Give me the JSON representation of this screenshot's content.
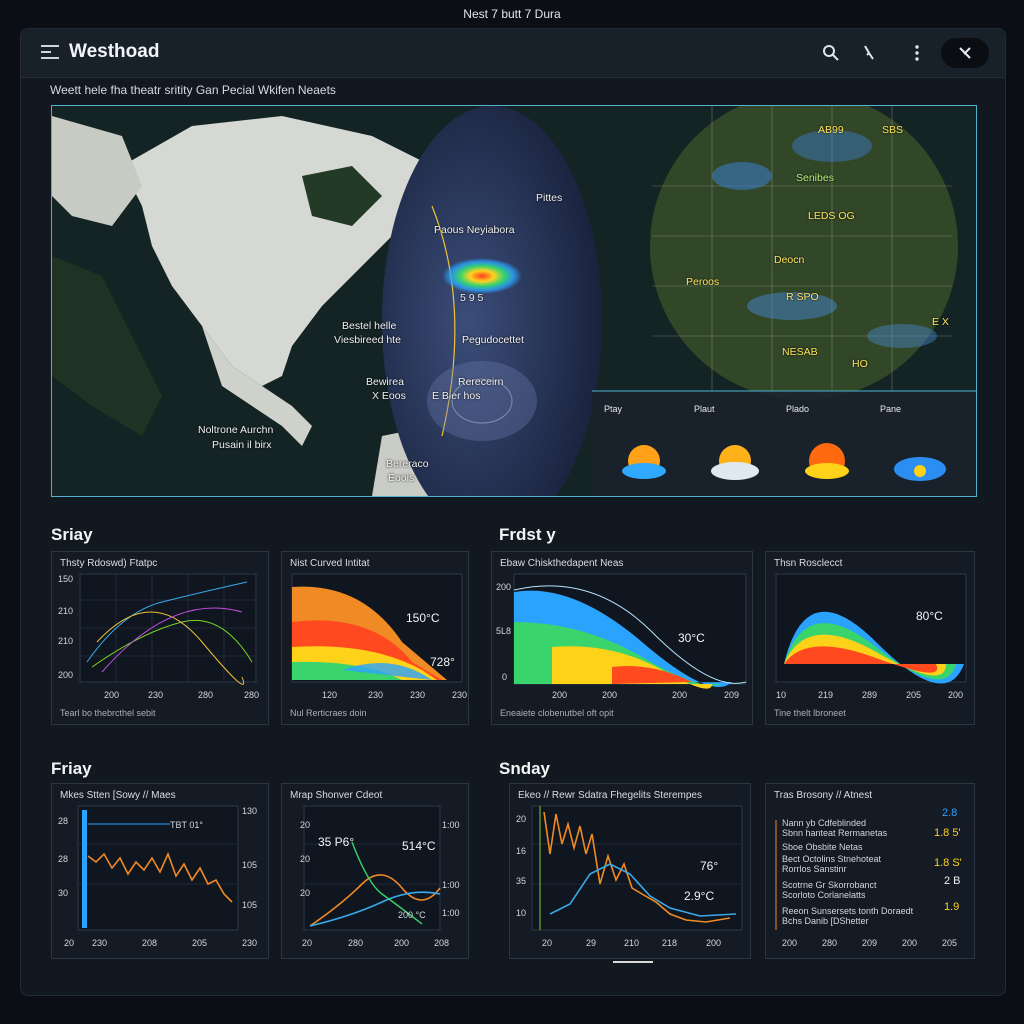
{
  "top_caption": "Nest 7 butt 7 Dura",
  "app": {
    "title": "Westhoad"
  },
  "subtitle": "Weett hele fha theatr sritity Gan Pecial Wkifen Neaets",
  "map": {
    "labels": {
      "pittes": "Pittes",
      "paous": "Paous Neyiabora",
      "val": "5 9 5",
      "bestel": "Bestel helle",
      "viesbireed": "Viesbireed hte",
      "pegudoc": "Pegudocettet",
      "bewirea": "Bewirea",
      "eoos": "X Eoos",
      "rereceirn": "Rereceirn",
      "ebierhos": "E Bier hos",
      "noltrone": "Noltrone Aurchn",
      "pusain": "Pusain il birx",
      "bereraco": "Bereraco",
      "eoois": "Eoois",
      "senibes": "Senibes",
      "ledos": "LEDS OG",
      "peroos": "Peroos",
      "deocn": "Deocn",
      "sbs": "SBS",
      "rspo": "R SPO",
      "nesab": "NESAB",
      "ho": "HO",
      "ab99": "AB99",
      "ex": "E X"
    },
    "thumbs": [
      "Ptay",
      "Plaut",
      "Plado",
      "Pane"
    ]
  },
  "sections": {
    "s1": "Sriay",
    "s2": "Frdst y",
    "s3": "Friay",
    "s4": "Sndaу"
  },
  "panels": [
    {
      "title": "Thsty Rdoswd) Ftatpc",
      "note": "Tearl bo thebrcthel sebit",
      "yticks": [
        "150",
        "210",
        "210",
        "200"
      ],
      "xticks": [
        "200",
        "230",
        "280",
        "280"
      ]
    },
    {
      "title": "Nist Curved Intitat",
      "note": "Nul Rerticraes doin",
      "xticks": [
        "120",
        "230",
        "230",
        "230"
      ],
      "v1": "150°C",
      "v2": "728°"
    },
    {
      "title": "Ebaw Chiskthedapent Neas",
      "note": "Eneaiete clobenutbel oft opit",
      "yticks": [
        "200",
        "5L8",
        "0"
      ],
      "xticks": [
        "200",
        "200",
        "200",
        "209"
      ],
      "v1": "30°C"
    },
    {
      "title": "Thsn Rosclecct",
      "note": "Tine thelt lbroneet",
      "xticks": [
        "10",
        "219",
        "289",
        "205",
        "200"
      ],
      "v1": "80°C"
    },
    {
      "title": "Mkes Stten [Sowy // Maes",
      "yticks": [
        "28",
        "28",
        "30"
      ],
      "rticks": [
        "130",
        "105",
        "105"
      ],
      "xticks": [
        "20",
        "230",
        "208",
        "205",
        "230"
      ],
      "v1": "TBT 01°"
    },
    {
      "title": "Mrap Shonver Cdeot",
      "yticks": [
        "20",
        "20",
        "20"
      ],
      "rticks": [
        "1:00",
        "1:00",
        "1:00"
      ],
      "xticks": [
        "20",
        "280",
        "200",
        "208"
      ],
      "v1": "35 P6°",
      "v2": "514°C",
      "v3": "200 °C"
    },
    {
      "title": "Ekeo // Rewr Sdatra Fhegelits Sterempes",
      "yticks": [
        "20",
        "16",
        "35",
        "10"
      ],
      "xticks": [
        "20",
        "29",
        "210",
        "218",
        "200"
      ],
      "v1": "76°",
      "v2": "2.9°C"
    },
    {
      "title": "Tras Brosony // Atnest",
      "xticks": [
        "200",
        "280",
        "209",
        "200",
        "205"
      ],
      "rows": [
        {
          "label": "Nann yb Cdfeblinded",
          "label2": "Sbnn hanteat Rermanetas",
          "val": "1.8 5'"
        },
        {
          "label": "Sboe Obsbite Netas",
          "val": "1.8 S'"
        },
        {
          "label": "Bect Octolins Stnehoteat",
          "label2": "Rorrlos Sanstinr",
          "val": "2 B"
        },
        {
          "label": "Scotrne Gr Skorrobanct",
          "label2": "Scorloto Corlanelatts",
          "val": "1.9"
        },
        {
          "label": "Reeon Sunsersets tonth Doraedt",
          "label2": "Bchs Danib [DShetter",
          "val": ""
        }
      ],
      "top_val": "2.8"
    }
  ],
  "colors": {
    "accent": "#4fb3cf",
    "orange": "#f08a24",
    "blue": "#3aa8e8",
    "green": "#7ed321"
  }
}
